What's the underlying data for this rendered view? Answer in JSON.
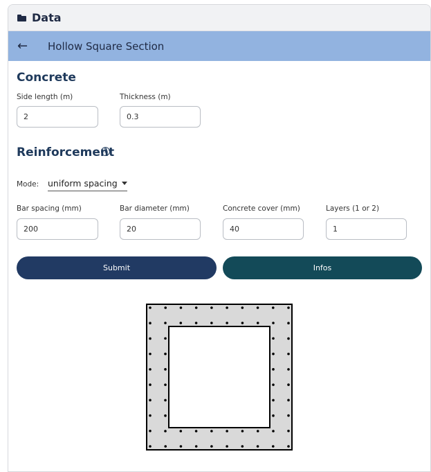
{
  "header": {
    "title": "Data",
    "icon": "folder-icon"
  },
  "nav": {
    "title": "Hollow Square Section",
    "back_icon": "arrow-left-icon"
  },
  "concrete": {
    "title": "Concrete",
    "side_length": {
      "label": "Side length (m)",
      "value": "2"
    },
    "thickness": {
      "label": "Thickness (m)",
      "value": "0.3"
    }
  },
  "reinforcement": {
    "title": "Reinforcement",
    "help_icon": "question-circle-icon",
    "mode": {
      "label": "Mode:",
      "selected": "uniform spacing"
    },
    "bar_spacing": {
      "label": "Bar spacing (mm)",
      "value": "200"
    },
    "bar_diameter": {
      "label": "Bar diameter (mm)",
      "value": "20"
    },
    "concrete_cover": {
      "label": "Concrete cover (mm)",
      "value": "40"
    },
    "layers": {
      "label": "Layers (1 or 2)",
      "value": "1"
    }
  },
  "buttons": {
    "submit": "Submit",
    "infos": "Infos"
  },
  "colors": {
    "nav_bar": "#92b3e0",
    "submit_button": "#213a63",
    "infos_button": "#134a58",
    "section_fill": "#d9d9d9"
  }
}
